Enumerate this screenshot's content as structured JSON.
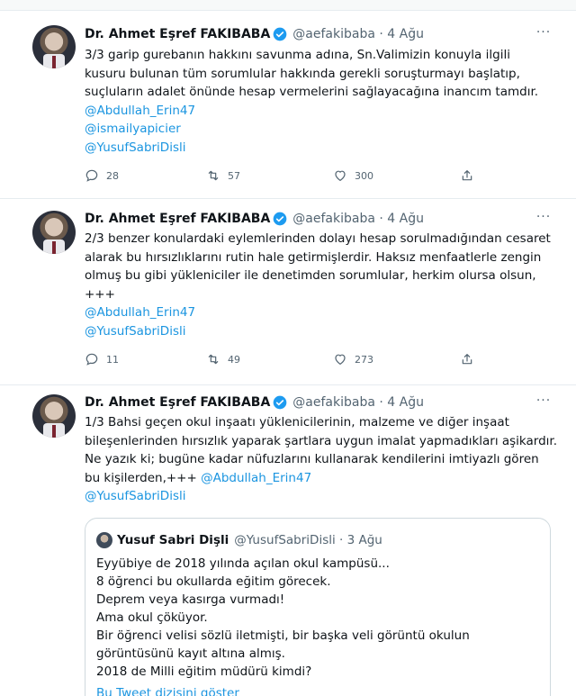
{
  "tweets": [
    {
      "name": "Dr. Ahmet Eşref FAKIBABA",
      "handle_time": "@aefakibaba · 4 Ağu",
      "more": "···",
      "lines": [
        "3/3  garip gurebanın hakkını savunma adına, Sn.Valimizin konuyla ilgili",
        "kusuru bulunan tüm sorumlular hakkında gerekli soruşturmayı başlatıp,",
        "suçluların adalet önünde hesap vermelerini sağlayacağına inancım tamdır."
      ],
      "mentions": [
        "@Abdullah_Erin47",
        "@ismailyapicier",
        "@YusufSabriDisli"
      ],
      "replies": "28",
      "retweets": "57",
      "likes": "300"
    },
    {
      "name": "Dr. Ahmet Eşref FAKIBABA",
      "handle_time": "@aefakibaba · 4 Ağu",
      "more": "···",
      "lines": [
        "2/3  benzer konulardaki eylemlerinden dolayı hesap sorulmadığından cesaret",
        "alarak bu hırsızlıklarını rutin hale getirmişlerdir. Haksız menfaatlerle zengin",
        "olmuş bu gibi yükleniciler ile denetimden sorumlular, herkim olursa olsun,",
        "+++"
      ],
      "mentions": [
        "@Abdullah_Erin47",
        "@YusufSabriDisli"
      ],
      "replies": "11",
      "retweets": "49",
      "likes": "273"
    },
    {
      "name": "Dr. Ahmet Eşref FAKIBABA",
      "handle_time": "@aefakibaba · 4 Ağu",
      "more": "···",
      "lines": [
        "1/3 Bahsi geçen okul inşaatı  yüklenicilerinin, malzeme ve diğer inşaat",
        "bileşenlerinden hırsızlık yaparak şartlara uygun imalat yapmadıkları aşikardır.",
        "Ne yazık ki; bugüne kadar nüfuzlarını kullanarak kendilerini imtiyazlı gören",
        "bu kişilerden,+++"
      ],
      "inline_mention": "@Abdullah_Erin47",
      "mentions": [
        "@YusufSabriDisli"
      ]
    }
  ],
  "quote": {
    "name": "Yusuf Sabri Dişli",
    "handle_time": "@YusufSabriDisli · 3 Ağu",
    "lines": [
      "Eyyübiye de 2018 yılında açılan okul kampüsü...",
      "8 öğrenci bu okullarda eğitim görecek.",
      "Deprem veya kasırga vurmadı!",
      "Ama okul çöküyor.",
      "Bir öğrenci velisi sözlü iletmişti, bir başka veli görüntü okulun",
      "görüntüsünü kayıt altına almış.",
      "2018 de Milli eğitim müdürü kimdi?"
    ],
    "show_thread": "Bu Tweet dizisini göster"
  },
  "icons": [
    "reply-icon",
    "retweet-icon",
    "like-icon",
    "share-icon",
    "verified-badge-icon"
  ],
  "colors": {
    "link": "#1b95e0",
    "verified": "#1d9bf0",
    "muted": "#536471"
  }
}
